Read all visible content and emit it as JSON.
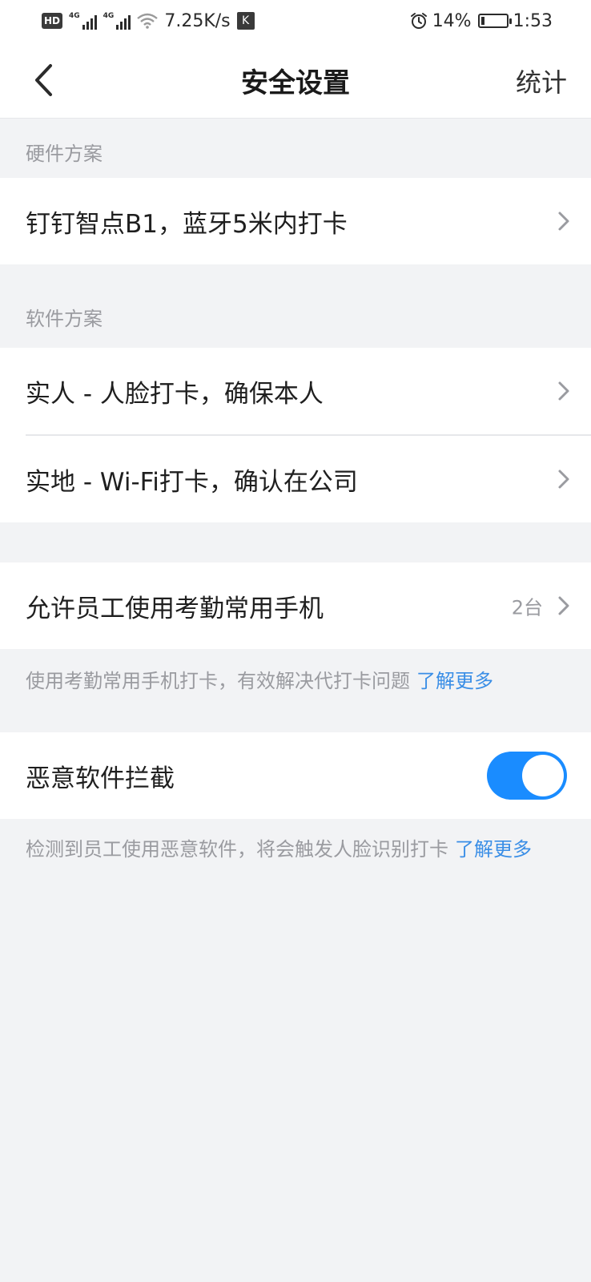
{
  "status_bar": {
    "hd_badge": "HD",
    "net_tag_1": "4G",
    "net_tag_2": "4G",
    "speed": "7.25K/s",
    "k_badge": "K",
    "battery_percent": "14%",
    "battery_level": 0.14,
    "time": "1:53",
    "icons": [
      "hd-icon",
      "signal-icon",
      "signal-icon",
      "wifi-icon",
      "app-k-icon",
      "alarm-icon",
      "battery-charging-icon"
    ]
  },
  "navbar": {
    "title": "安全设置",
    "action": "统计",
    "back_icon": "chevron-left-icon"
  },
  "hardware": {
    "header": "硬件方案",
    "items": [
      {
        "label": "钉钉智点B1，蓝牙5米内打卡"
      }
    ]
  },
  "software": {
    "header": "软件方案",
    "items": [
      {
        "label": "实人 - 人脸打卡，确保本人"
      },
      {
        "label": "实地 - Wi-Fi打卡，确认在公司"
      }
    ]
  },
  "phone": {
    "label": "允许员工使用考勤常用手机",
    "value": "2台",
    "hint": "使用考勤常用手机打卡，有效解决代打卡问题",
    "link": "了解更多"
  },
  "malware": {
    "label": "恶意软件拦截",
    "enabled": true,
    "hint": "检测到员工使用恶意软件，将会触发人脸识别打卡",
    "link": "了解更多"
  },
  "colors": {
    "accent": "#1a8cff",
    "link": "#3a8ee6",
    "background": "#f2f3f5",
    "muted_text": "#9a9ba0"
  }
}
